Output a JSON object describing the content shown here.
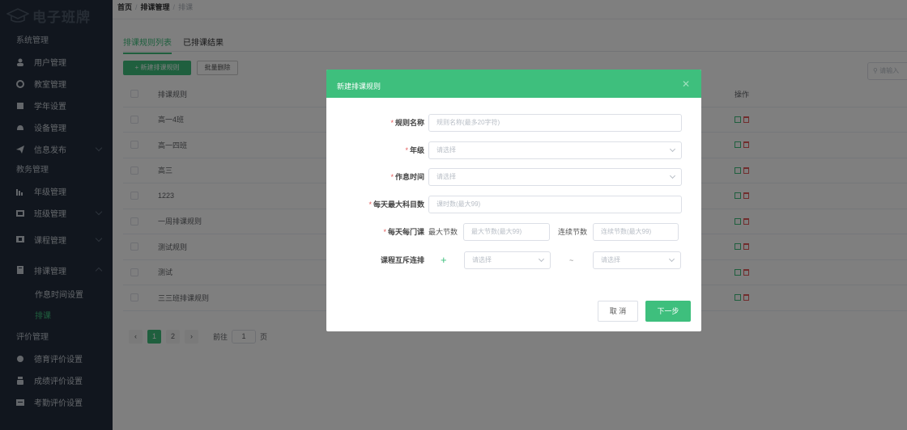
{
  "brand": {
    "title": "电子班牌"
  },
  "sidebar": {
    "group_system": "系统管理",
    "item_user": "用户管理",
    "item_classroom": "教室管理",
    "item_schoolyear": "学年设置",
    "item_device": "设备管理",
    "item_info": "信息发布",
    "group_academic": "教务管理",
    "item_grade": "年级管理",
    "item_class": "班级管理",
    "item_course": "课程管理",
    "item_schedule": "排课管理",
    "sub_rest": "作息时间设置",
    "sub_schedule": "排课",
    "group_eval": "评价管理",
    "item_moral": "德育评价设置",
    "item_score": "成绩评价设置",
    "item_attendance": "考勤评价设置"
  },
  "breadcrumb": {
    "home": "首页",
    "parent": "排课管理",
    "current": "排课"
  },
  "tabs": {
    "list": "排课规则列表",
    "result": "已排课结果"
  },
  "toolbar": {
    "new_label": "+ 新建排课规则",
    "batch_delete": "批量删除",
    "search_placeholder": "请输入"
  },
  "table": {
    "col_rule": "排课规则",
    "col_action": "操作",
    "rows": [
      "高一4班",
      "高一四班",
      "高三",
      "1223",
      "一周排课规则",
      "测试规则",
      "测试",
      "三三班排课规则"
    ]
  },
  "pager": {
    "page1": "1",
    "page2": "2",
    "goto_label": "前往",
    "goto_value": "1",
    "page_unit": "页"
  },
  "dialog": {
    "title": "新建排课规则",
    "label_name": "规则名称",
    "ph_name": "规则名称(最多20字符)",
    "label_grade": "年级",
    "ph_select": "请选择",
    "label_rest": "作息时间",
    "label_max_subjects": "每天最大科目数",
    "ph_max_subjects": "课时数(最大99)",
    "label_per_course": "每天每门课",
    "max_sections_label": "最大节数",
    "ph_max_sections": "最大节数(最大99)",
    "consecutive_label": "连续节数",
    "ph_consecutive": "连续节数(最大99)",
    "label_mutex": "课程互斥连排",
    "plus": "+",
    "tilde": "~",
    "cancel": "取 消",
    "next": "下一步",
    "asterisk": "*"
  },
  "colors": {
    "accent": "#3ebf7d",
    "sidebar_bg": "#222d3c",
    "danger": "#e35b5b"
  }
}
